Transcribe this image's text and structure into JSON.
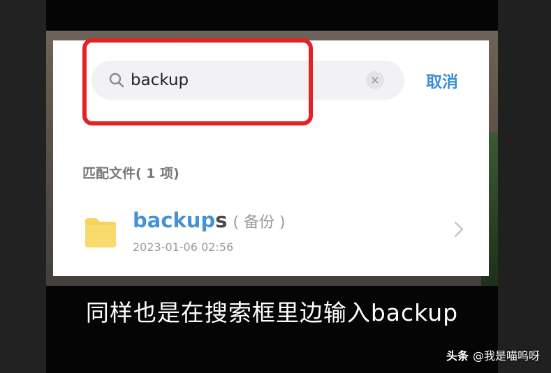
{
  "search": {
    "query": "backup",
    "clear_symbol": "×",
    "cancel_label": "取消"
  },
  "results": {
    "section_label": "匹配文件( 1 项)",
    "items": [
      {
        "name_match": "backup",
        "name_rest": "s",
        "name_alias": "( 备份 )",
        "date": "2023-01-06 02:56",
        "icon": "folder-icon"
      }
    ]
  },
  "subtitle": "同样也是在搜索框里边输入backup",
  "watermark": {
    "brand": "头条",
    "account": "@我是喵呜呀"
  },
  "colors": {
    "accent_blue": "#3c8ed6",
    "highlight_red": "#e42127",
    "folder_yellow": "#f7d35a"
  }
}
